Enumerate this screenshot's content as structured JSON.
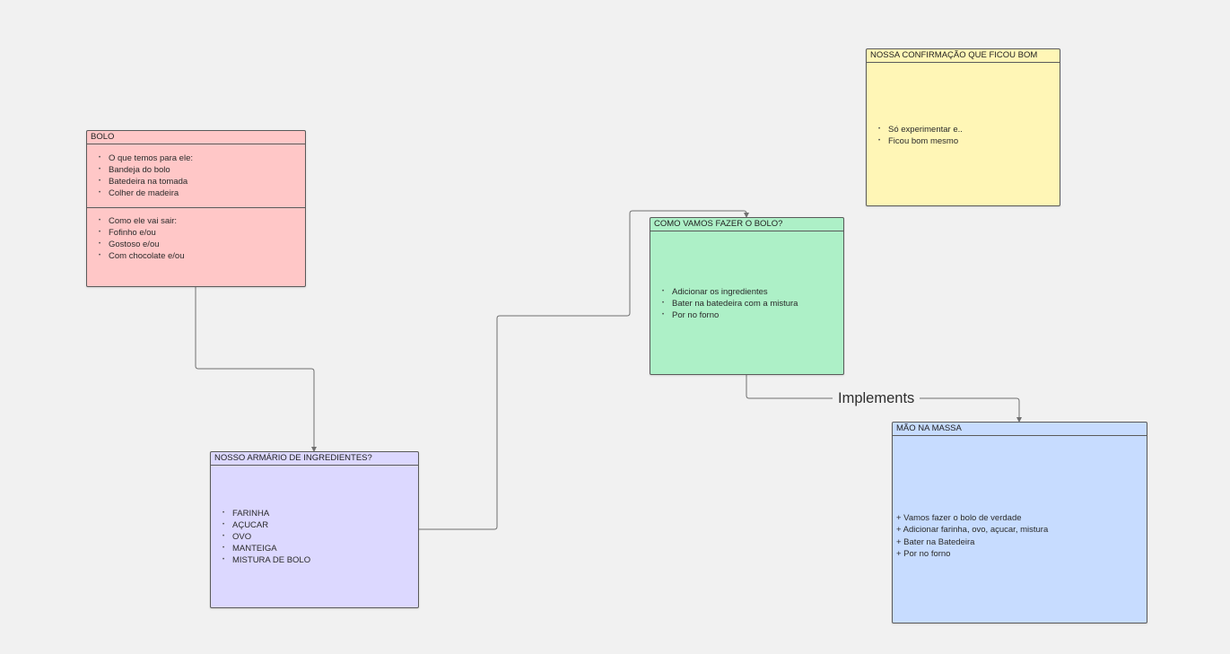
{
  "colors": {
    "background": "#f1f1f1",
    "connector": "#707070",
    "bolo_fill": "#ffc7c7",
    "armario_fill": "#dcd8ff",
    "como_fill": "#adf0c7",
    "mao_fill": "#c7dcff",
    "confirmacao_fill": "#fff6b6"
  },
  "nodes": {
    "bolo": {
      "title": "BOLO",
      "section1": [
        "O que temos para ele:",
        "Bandeja do bolo",
        "Batedeira na tomada",
        "Colher de madeira"
      ],
      "section2": [
        "Como ele vai sair:",
        "Fofinho e/ou",
        "Gostoso e/ou",
        "Com chocolate e/ou"
      ]
    },
    "armario": {
      "title": "NOSSO ARMÁRIO DE INGREDIENTES?",
      "items": [
        "FARINHA",
        "AÇUCAR",
        "OVO",
        "MANTEIGA",
        "MISTURA DE BOLO"
      ]
    },
    "como": {
      "title": "COMO VAMOS FAZER O BOLO?",
      "items": [
        "Adicionar os ingredientes",
        "Bater na batedeira com a mistura",
        "Por no forno"
      ]
    },
    "confirmacao": {
      "title": "NOSSA CONFIRMAÇÃO QUE FICOU BOM",
      "items": [
        "Só experimentar e..",
        "Ficou bom mesmo"
      ]
    },
    "mao": {
      "title": "MÃO NA MASSA",
      "items": [
        "+ Vamos fazer o bolo de verdade",
        "+ Adicionar farinha, ovo, açucar, mistura",
        "+ Bater na Batedeira",
        "+ Por no forno"
      ]
    }
  },
  "edges": {
    "implements_label": "Implements"
  }
}
